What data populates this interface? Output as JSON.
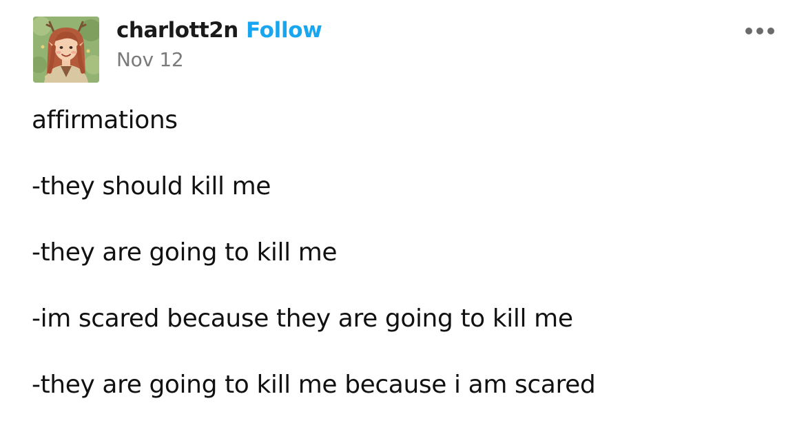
{
  "theme": {
    "follow_color": "#19a6f0",
    "date_color": "#7a7a7a",
    "text_color": "#111111"
  },
  "post": {
    "author": {
      "username": "charlott2n",
      "follow_label": "Follow",
      "avatar_icon": "avatar-illustration-icon"
    },
    "date": "Nov 12",
    "more_icon": "ellipsis-icon",
    "lines": [
      "affirmations",
      "-they should kill me",
      "-they are going to kill me",
      "-im scared because they are going to kill me",
      "-they are going to kill me because i am scared"
    ]
  }
}
